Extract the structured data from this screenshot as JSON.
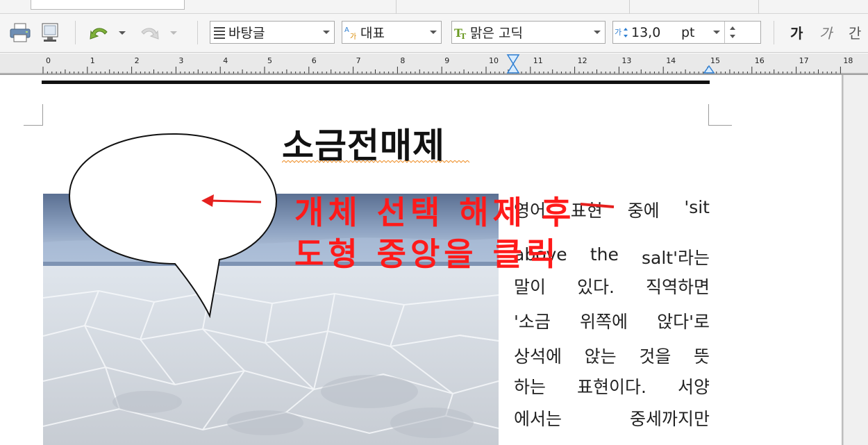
{
  "toolbar": {
    "style_value": "바탕글",
    "language_value": "대표",
    "font_value": "맑은 고딕",
    "size_value": "13,0",
    "size_unit": "pt",
    "bold_label": "가",
    "italic_label": "가",
    "underline_label": "간"
  },
  "ruler": {
    "marks": [
      "0",
      "1",
      "2",
      "3",
      "4",
      "5",
      "6",
      "7",
      "8",
      "9",
      "10",
      "11",
      "12",
      "13",
      "14",
      "15",
      "16",
      "17",
      "18"
    ]
  },
  "document": {
    "title": "소금전매제",
    "body_lines": [
      [
        "영어",
        "표현",
        "중에",
        "'sit"
      ],
      [
        "above",
        "the",
        "salt'라는"
      ],
      [
        "말이",
        "있다.",
        "직역하면"
      ],
      [
        "'소금",
        "위쪽에",
        "앉다'로"
      ],
      [
        "상석에",
        "앉는",
        "것을",
        "뜻"
      ],
      [
        "하는",
        "표현이다.",
        "서양"
      ],
      [
        "에서는",
        "중세까지만"
      ]
    ]
  },
  "annotation": {
    "line1": "개체 선택 해제 후",
    "line2": "도형 중앙을 클릭"
  },
  "colors": {
    "annotation": "#ff1a1a",
    "accent": "#2f7fd2"
  }
}
